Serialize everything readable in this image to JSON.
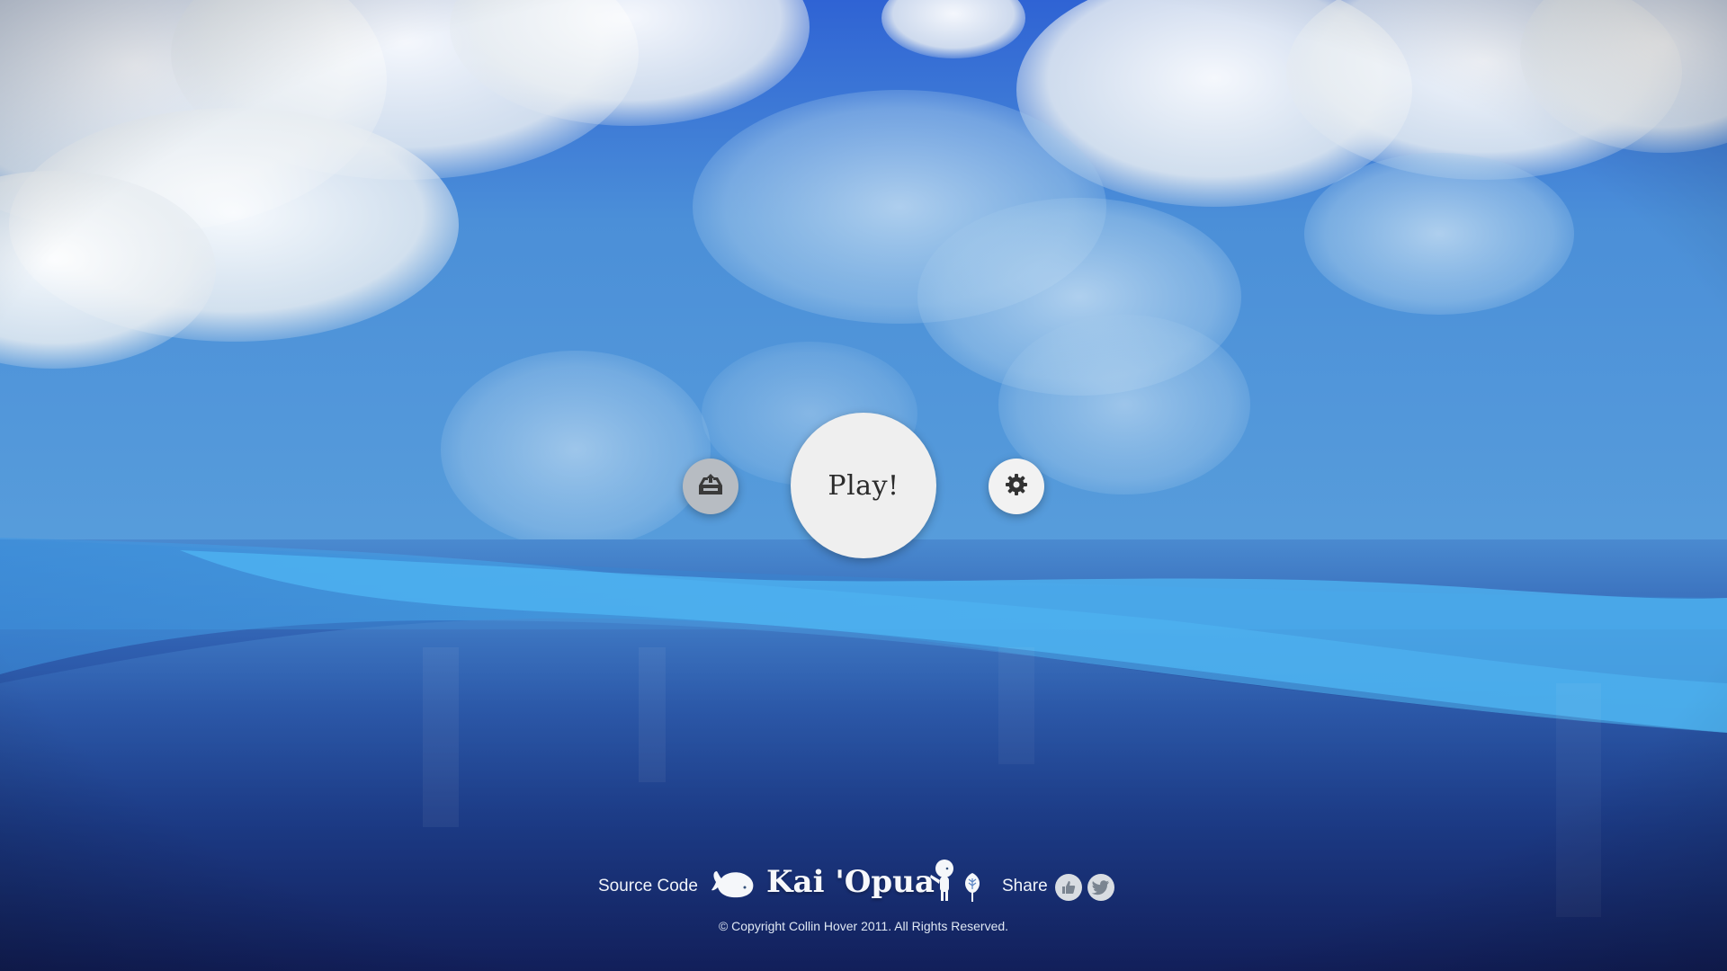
{
  "menu": {
    "play_label": "Play!",
    "load_icon": "inbox-upload-icon",
    "settings_icon": "gear-icon"
  },
  "footer": {
    "source_code_label": "Source Code",
    "brand_title": "Kai 'Opua",
    "share_label": "Share",
    "copyright": "© Copyright Collin Hover 2011. All Rights Reserved.",
    "icons": [
      "whale-icon",
      "character-icon",
      "tree-icon",
      "thumbs-up-icon",
      "twitter-bird-icon"
    ]
  },
  "colors": {
    "sky_top": "#3a78d8",
    "sky_mid": "#5a9ddd",
    "water_light": "#4db8f2",
    "water_deep": "#14225e",
    "button_light": "#efefef",
    "button_gray": "#b7bcc2"
  }
}
